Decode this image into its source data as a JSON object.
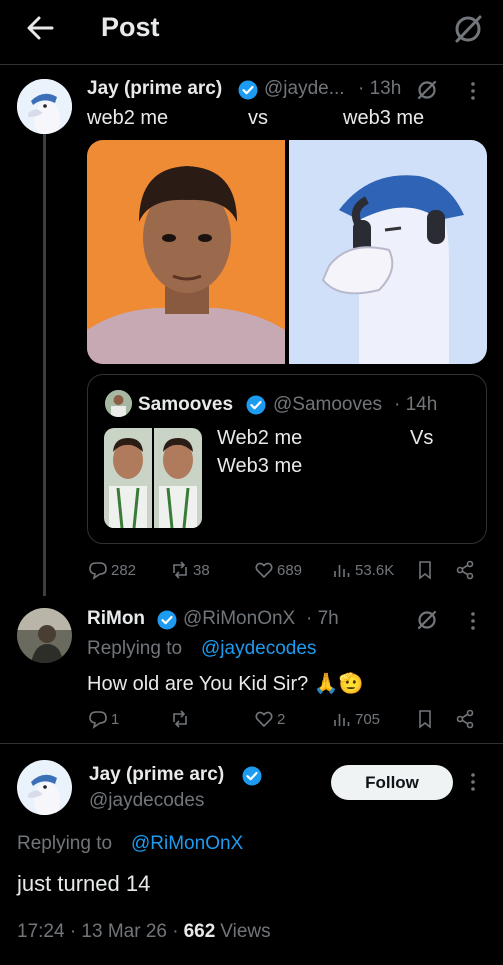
{
  "header": {
    "title": "Post"
  },
  "post": {
    "author_name": "Jay (prime arc)",
    "handle": "@jayde...",
    "time": "· 13h",
    "text_left": "web2 me",
    "text_mid": "vs",
    "text_right": "web3 me",
    "quote": {
      "author_name": "Samooves",
      "handle": "@Samooves",
      "time": "· 14h",
      "text_a": "Web2 me",
      "text_vs": "Vs",
      "text_b": "Web3 me"
    },
    "stats": {
      "replies": "282",
      "reposts": "38",
      "likes": "689",
      "views": "53.6K"
    }
  },
  "reply": {
    "author_name": "RiMon",
    "handle": "@RiMonOnX",
    "time": "· 7h",
    "replying_prefix": "Replying to",
    "replying_to": "@jaydecodes",
    "text": "How old are You Kid Sir? 🙏🫡",
    "stats": {
      "replies": "1",
      "reposts": "",
      "likes": "2",
      "views": "705"
    }
  },
  "focus": {
    "author_name": "Jay (prime arc)",
    "handle": "@jaydecodes",
    "follow_label": "Follow",
    "replying_prefix": "Replying to",
    "replying_to": "@RiMonOnX",
    "text": "just turned 14",
    "timestamp": "17:24 · 13 Mar 26 ·",
    "views_count": "662",
    "views_label": "Views"
  },
  "colors": {
    "accent": "#1d9bf0",
    "background": "#000000",
    "muted": "#71767b",
    "text": "#e7e9ea"
  }
}
